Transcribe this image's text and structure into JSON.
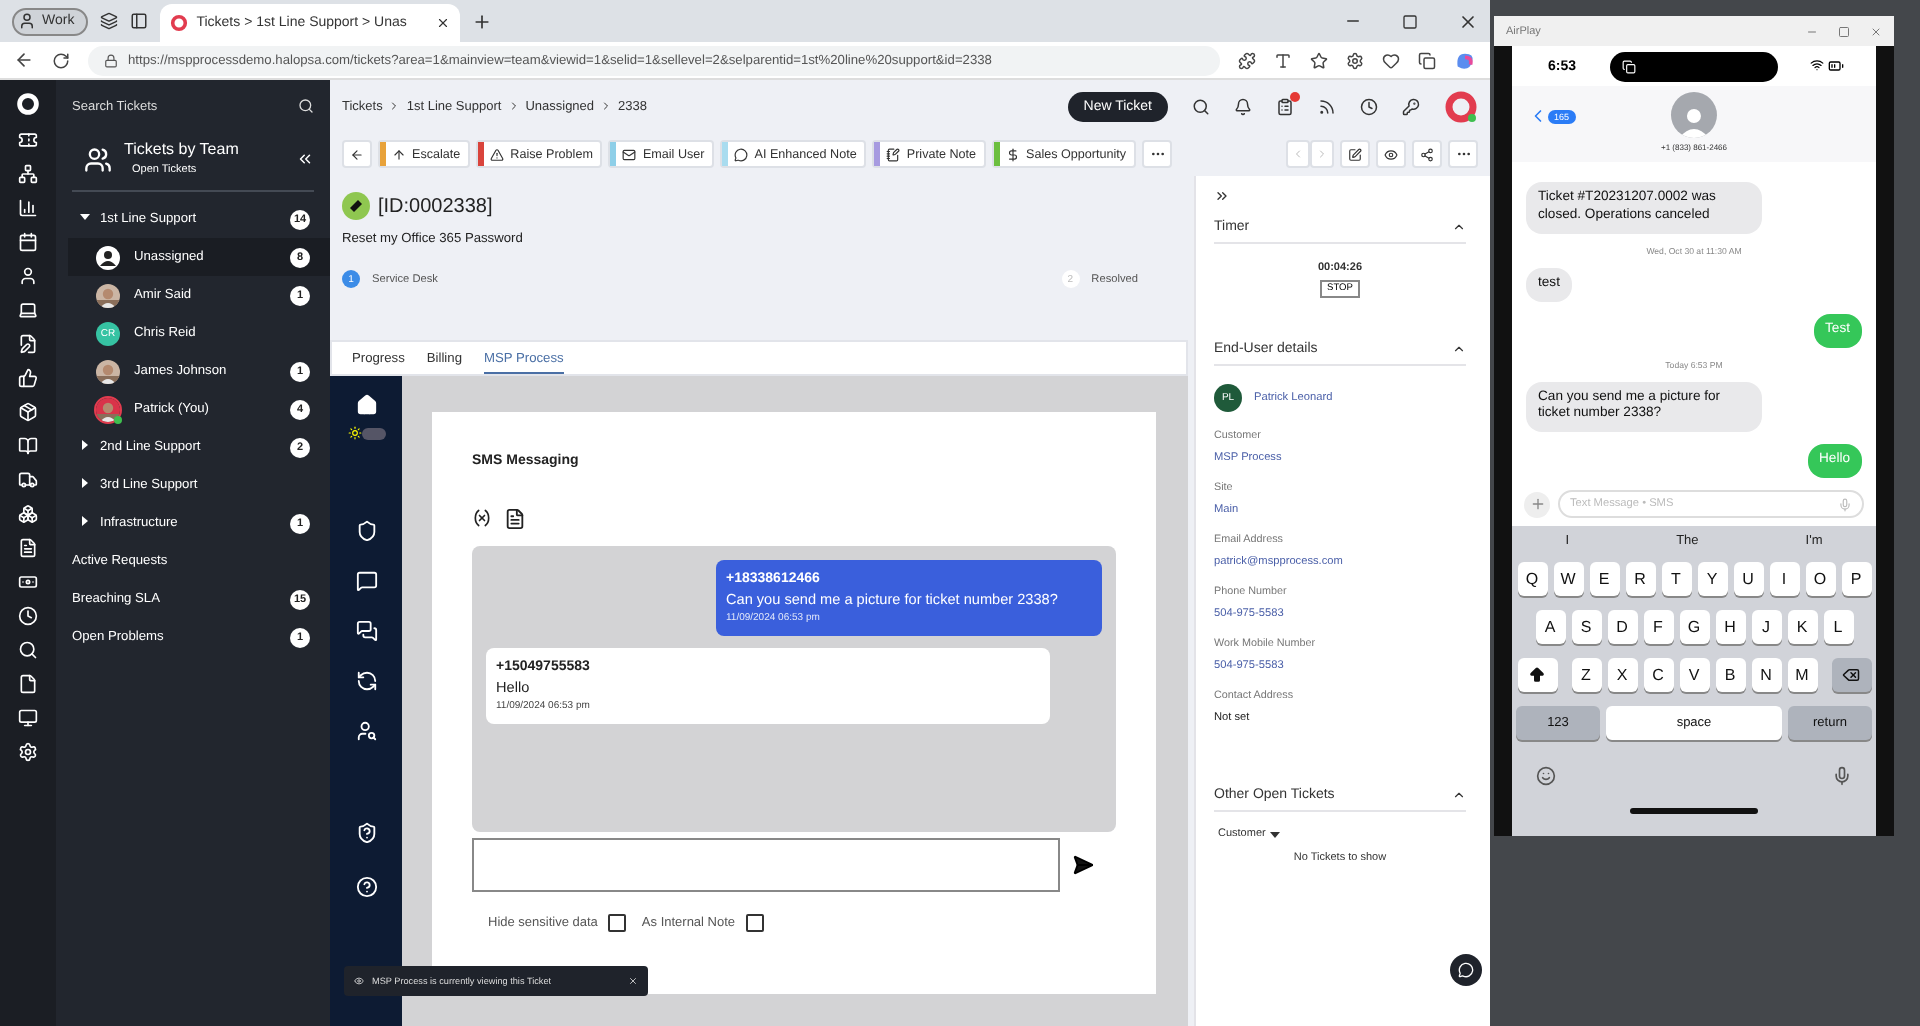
{
  "browser": {
    "profile": "Work",
    "tab_title": "Tickets > 1st Line Support > Unas",
    "url": "https://mspprocessdemo.halopsa.com/tickets?area=1&mainview=team&viewid=1&selid=1&sellevel=2&selparentid=1st%20line%20support&id=2338"
  },
  "sidebar": {
    "search_placeholder": "Search Tickets",
    "title": "Tickets by Team",
    "subtitle": "Open Tickets",
    "teams": [
      {
        "label": "1st Line Support",
        "count": "14",
        "expanded": true,
        "children": [
          {
            "label": "Unassigned",
            "count": "8",
            "selected": true,
            "kind": "person",
            "online": false
          },
          {
            "label": "Amir Said",
            "count": "1",
            "selected": false,
            "online": false
          },
          {
            "label": "Chris Reid",
            "selected": false,
            "kind": "initials",
            "initials": "CR",
            "online": false
          },
          {
            "label": "James Johnson",
            "count": "1",
            "selected": false,
            "online": false
          },
          {
            "label": "Patrick (You)",
            "count": "4",
            "selected": false,
            "online": true
          }
        ]
      },
      {
        "label": "2nd Line Support",
        "count": "2",
        "expanded": false
      },
      {
        "label": "3rd Line Support",
        "expanded": false
      },
      {
        "label": "Infrastructure",
        "count": "1",
        "expanded": false
      }
    ],
    "views": [
      {
        "label": "Active Requests"
      },
      {
        "label": "Breaching SLA",
        "count": "15"
      },
      {
        "label": "Open Problems",
        "count": "1"
      }
    ]
  },
  "header": {
    "breadcrumb": [
      "Tickets",
      "1st Line Support",
      "Unassigned",
      "2338"
    ],
    "new_ticket": "New Ticket"
  },
  "actions": [
    {
      "label": "Escalate",
      "color": "#e8a23a"
    },
    {
      "label": "Raise Problem",
      "color": "#d9443c"
    },
    {
      "label": "Email User",
      "color": "#8ecfe8"
    },
    {
      "label": "AI Enhanced Note",
      "color": "#a9dcef"
    },
    {
      "label": "Private Note",
      "color": "#a79be0"
    },
    {
      "label": "Sales Opportunity",
      "color": "#6cbf3f"
    }
  ],
  "ticket": {
    "id": "[ID:0002338]",
    "summary": "Reset my Office 365 Password",
    "stages": [
      {
        "number": "1",
        "label": "Service Desk",
        "selected": true
      },
      {
        "number": "2",
        "label": "Resolved",
        "selected": false
      }
    ]
  },
  "tabs": [
    {
      "label": "Progress",
      "selected": false
    },
    {
      "label": "Billing",
      "selected": false
    },
    {
      "label": "MSP Process",
      "selected": true
    }
  ],
  "sms": {
    "title": "SMS Messaging",
    "messages": [
      {
        "kind": "outgoing",
        "number": "+18338612466",
        "text": "Can you send me a picture for ticket number 2338?",
        "time": "11/09/2024 06:53 pm"
      },
      {
        "kind": "incoming",
        "number": "+15049755583",
        "text": "Hello",
        "time": "11/09/2024 06:53 pm"
      }
    ],
    "options": [
      {
        "label": "Hide sensitive data",
        "checked": false
      },
      {
        "label": "As Internal Note",
        "checked": false
      }
    ]
  },
  "toast": "MSP Process is currently viewing this Ticket",
  "details": {
    "timer": {
      "title": "Timer",
      "value": "00:04:26",
      "button": "STOP"
    },
    "end_user": {
      "title": "End-User details",
      "initials": "PL",
      "name": "Patrick Leonard",
      "fields": [
        {
          "label": "Customer",
          "value": "MSP Process",
          "kind": "link"
        },
        {
          "label": "Site",
          "value": "Main",
          "kind": "link"
        },
        {
          "label": "Email Address",
          "value": "patrick@mspprocess.com",
          "kind": "link"
        },
        {
          "label": "Phone Number",
          "value": "504-975-5583",
          "kind": "link"
        },
        {
          "label": "Work Mobile Number",
          "value": "504-975-5583",
          "kind": "link"
        },
        {
          "label": "Contact Address",
          "value": "Not set",
          "kind": "plain"
        }
      ]
    },
    "other_tickets": {
      "title": "Other Open Tickets",
      "filter": "Customer",
      "empty": "No Tickets to show"
    }
  },
  "phone": {
    "window_title": "AirPlay",
    "time": "6:53",
    "back_count": "165",
    "contact": "+1 (833) 861-2466",
    "messages": [
      {
        "kind": "incoming",
        "text": "Ticket #T20231207.0002 was closed. Operations canceled"
      },
      {
        "kind": "timestamp",
        "text": "Wed, Oct 30 at 11:30 AM"
      },
      {
        "kind": "incoming",
        "text": "test"
      },
      {
        "kind": "outgoing",
        "text": "Test"
      },
      {
        "kind": "timestamp",
        "text": "Today 6:53 PM"
      },
      {
        "kind": "incoming",
        "text": "Can you send me a picture for ticket number 2338?"
      },
      {
        "kind": "outgoing",
        "text": "Hello"
      }
    ],
    "placeholder": "Text Message • SMS",
    "suggestions": [
      "I",
      "The",
      "I'm"
    ],
    "keys": [
      [
        "Q",
        "W",
        "E",
        "R",
        "T",
        "Y",
        "U",
        "I",
        "O",
        "P"
      ],
      [
        "A",
        "S",
        "D",
        "F",
        "G",
        "H",
        "J",
        "K",
        "L"
      ],
      [
        "Z",
        "X",
        "C",
        "V",
        "B",
        "N",
        "M"
      ]
    ],
    "numbers_key": "123",
    "space_key": "space",
    "return_key": "return"
  }
}
